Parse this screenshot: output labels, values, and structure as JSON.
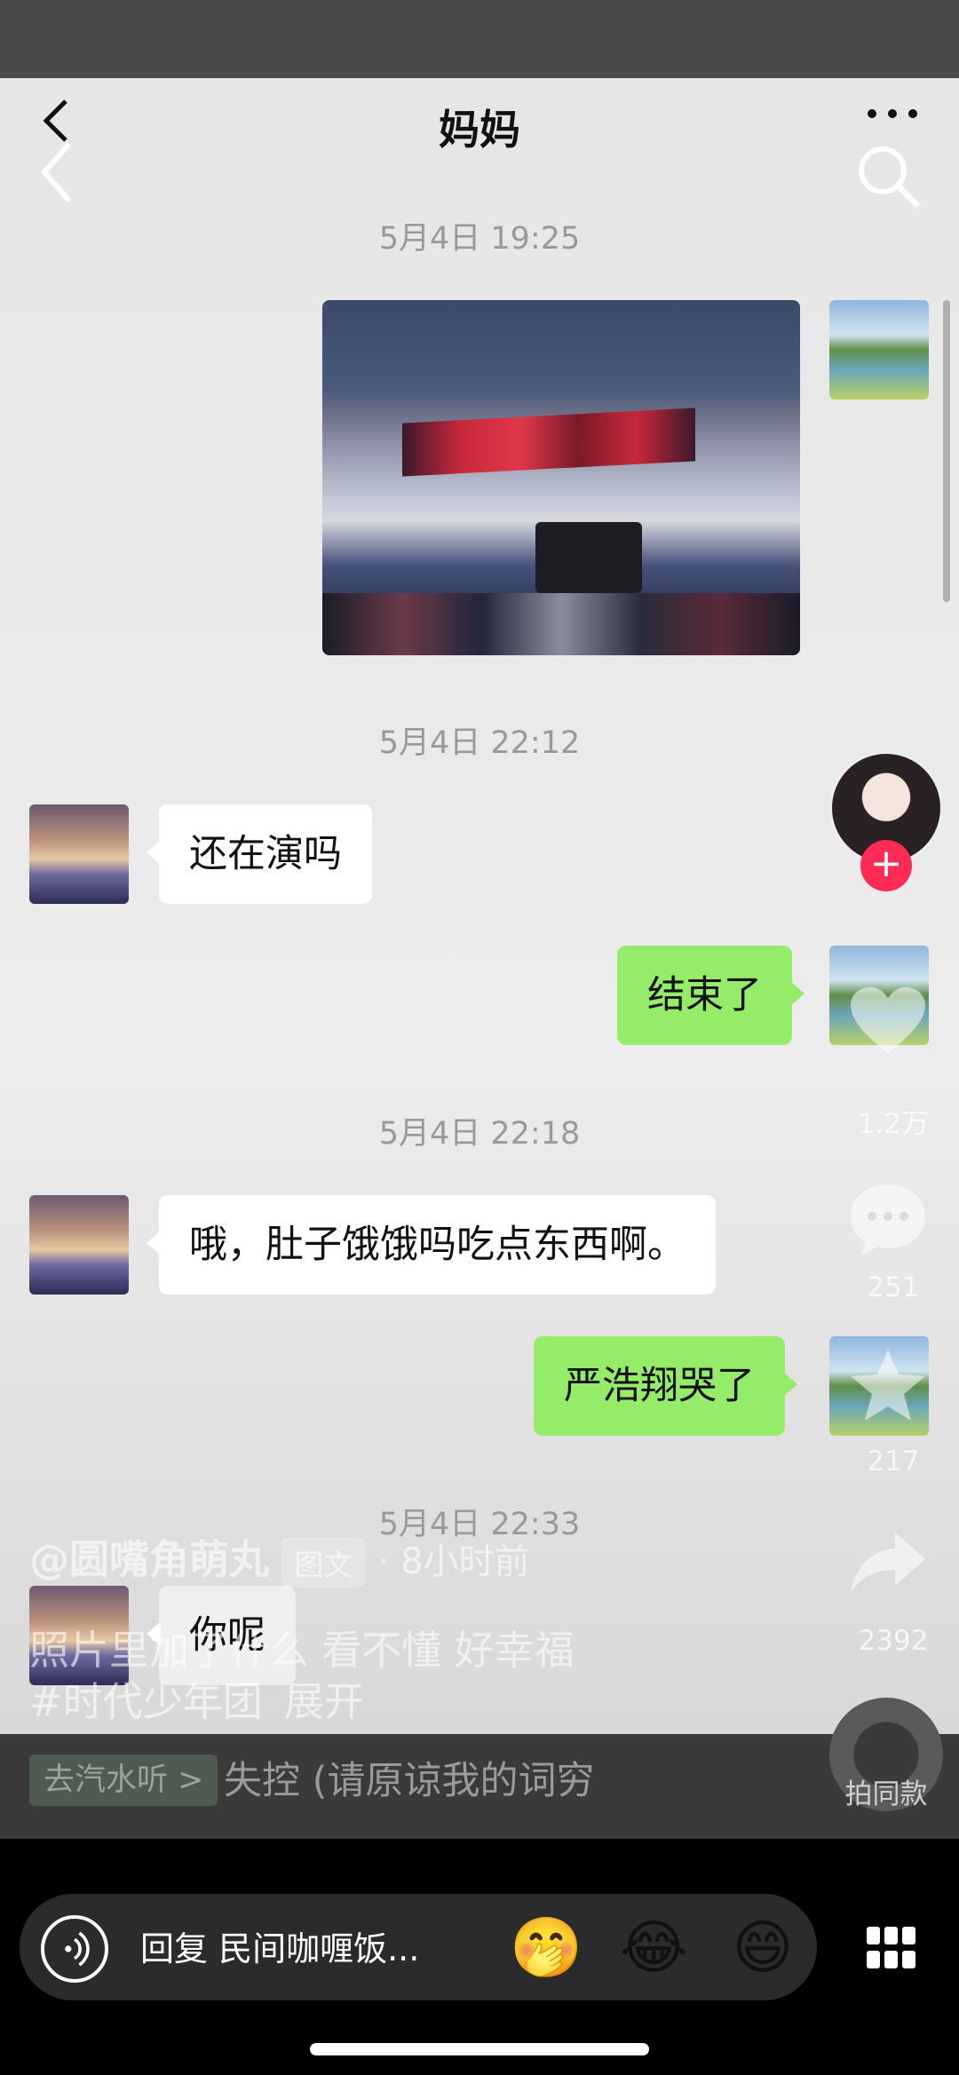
{
  "header": {
    "title": "妈妈"
  },
  "messages": {
    "t1": "5月4日 19:25",
    "t2": "5月4日 22:12",
    "m1": "还在演吗",
    "r1": "结束了",
    "t3": "5月4日 22:18",
    "m2": "哦，肚子饿饿吗吃点东西啊。",
    "r2": "严浩翔哭了",
    "t4": "5月4日 22:33",
    "m3": "你呢"
  },
  "side": {
    "likes": "1.2万",
    "comments": "251",
    "favorites": "217",
    "shares": "2392",
    "same_label": "拍同款"
  },
  "post": {
    "author": "@圆嘴角萌丸",
    "type_tag": "图文",
    "time_ago": "· 8小时前",
    "caption": "照片里加了什么 看不懂 好幸福",
    "hashtag": "#时代少年团",
    "expand": "展开"
  },
  "music": {
    "button": "去汽水听 >",
    "title": "失控 (请原谅我的词穷"
  },
  "bottom_bar": {
    "reply_placeholder": "回复 民间咖喱饭...",
    "emojis": [
      "🤭",
      "😂",
      "😄"
    ]
  },
  "colors": {
    "bubble_right": "#95ec69",
    "bubble_left": "#ffffff",
    "follow": "#fe2c55"
  }
}
